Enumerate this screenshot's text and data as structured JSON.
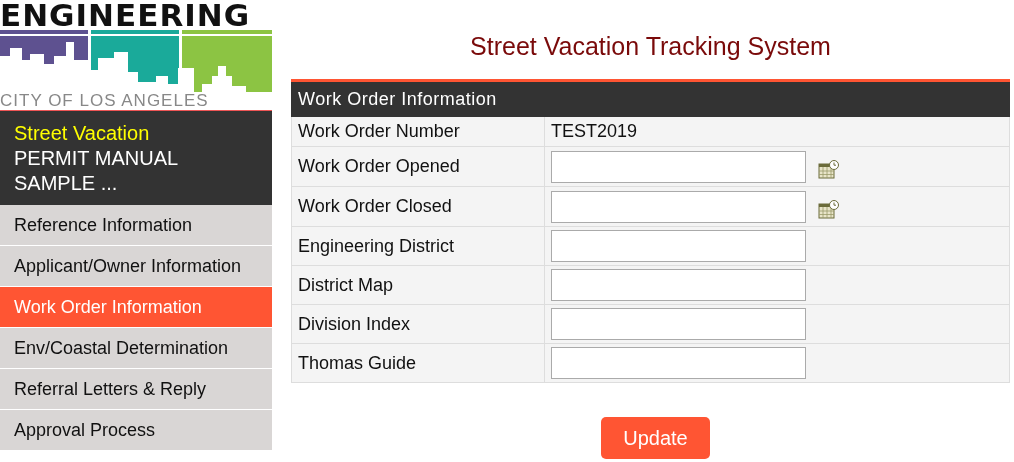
{
  "logo": {
    "title": "ENGINEERING",
    "subtitle": "CITY OF LOS ANGELES"
  },
  "project": {
    "name": "Street Vacation",
    "description": "PERMIT MANUAL SAMPLE ..."
  },
  "sidebar": {
    "items": [
      {
        "label": "Reference Information",
        "selected": false
      },
      {
        "label": "Applicant/Owner Information",
        "selected": false
      },
      {
        "label": "Work Order Information",
        "selected": true
      },
      {
        "label": "Env/Coastal Determination",
        "selected": false
      },
      {
        "label": "Referral Letters & Reply",
        "selected": false
      },
      {
        "label": "Approval Process",
        "selected": false
      }
    ]
  },
  "page_title": "Street Vacation Tracking System",
  "form": {
    "title": "Work Order Information",
    "rows": [
      {
        "label": "Work Order Number",
        "kind": "text",
        "value": "TEST2019"
      },
      {
        "label": "Work Order Opened",
        "kind": "date"
      },
      {
        "label": "Work Order Closed",
        "kind": "date"
      },
      {
        "label": "Engineering District",
        "kind": "input"
      },
      {
        "label": "District Map",
        "kind": "input"
      },
      {
        "label": "Division Index",
        "kind": "input"
      },
      {
        "label": "Thomas Guide",
        "kind": "input"
      }
    ]
  },
  "button": "Update"
}
